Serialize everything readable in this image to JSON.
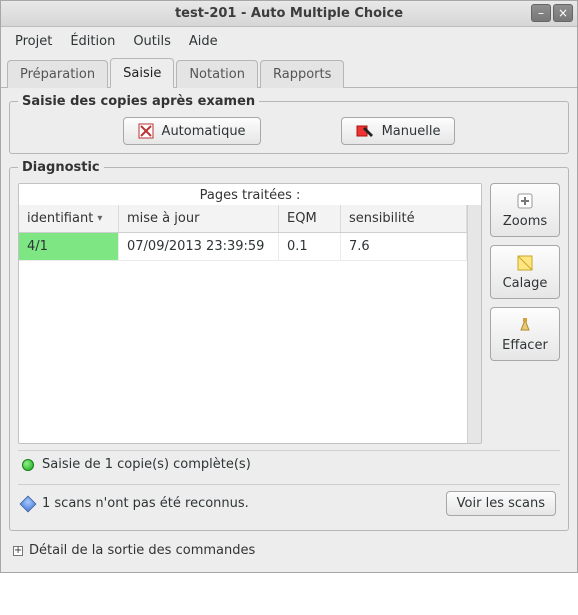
{
  "window": {
    "title": "test-201 - Auto Multiple Choice"
  },
  "menu": {
    "project": "Projet",
    "edition": "Édition",
    "tools": "Outils",
    "help": "Aide"
  },
  "tabs": {
    "preparation": "Préparation",
    "input": "Saisie",
    "grading": "Notation",
    "reports": "Rapports",
    "active": "input"
  },
  "capture": {
    "legend": "Saisie des copies après examen",
    "auto": "Automatique",
    "manual": "Manuelle"
  },
  "diagnostic": {
    "legend": "Diagnostic",
    "caption": "Pages traitées :",
    "columns": {
      "id": "identifiant",
      "updated": "mise à jour",
      "eqm": "EQM",
      "sensitivity": "sensibilité"
    },
    "rows": [
      {
        "id": "4/1",
        "updated": "07/09/2013 23:39:59",
        "eqm": "0.1",
        "sensitivity": "7.6",
        "highlight": true
      }
    ],
    "buttons": {
      "zooms": "Zooms",
      "calage": "Calage",
      "effacer": "Effacer"
    },
    "status_ok": "Saisie de 1 copie(s) complète(s)",
    "status_warn": "1 scans n'ont pas été reconnus.",
    "view_scans": "Voir les scans"
  },
  "expander": {
    "label": "Détail de la sortie des commandes"
  },
  "colors": {
    "row_highlight": "#7ee683"
  }
}
